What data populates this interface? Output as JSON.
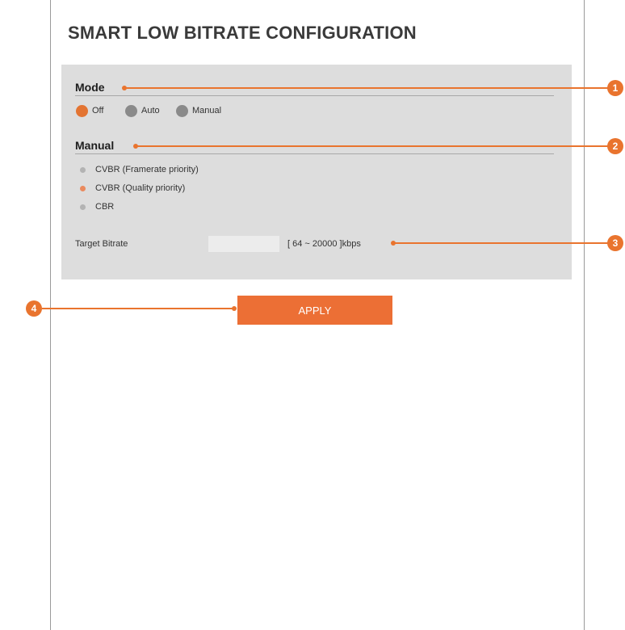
{
  "page": {
    "title": "SMART LOW BITRATE CONFIGURATION"
  },
  "mode": {
    "heading": "Mode",
    "options": [
      {
        "label": "Off",
        "selected": true
      },
      {
        "label": "Auto",
        "selected": false
      },
      {
        "label": "Manual",
        "selected": false
      }
    ]
  },
  "manual": {
    "heading": "Manual",
    "options": [
      {
        "label": "CVBR (Framerate priority)",
        "selected": false
      },
      {
        "label": "CVBR (Quality priority)",
        "selected": true
      },
      {
        "label": "CBR",
        "selected": false
      }
    ]
  },
  "target_bitrate": {
    "label": "Target Bitrate",
    "value": "",
    "range": "[ 64 ~ 20000 ]kbps"
  },
  "apply_label": "APPLY",
  "callouts": [
    "1",
    "2",
    "3",
    "4"
  ],
  "colors": {
    "accent": "#e9742e",
    "panel": "#dddddd",
    "radio_off": "#8a8a8a"
  }
}
